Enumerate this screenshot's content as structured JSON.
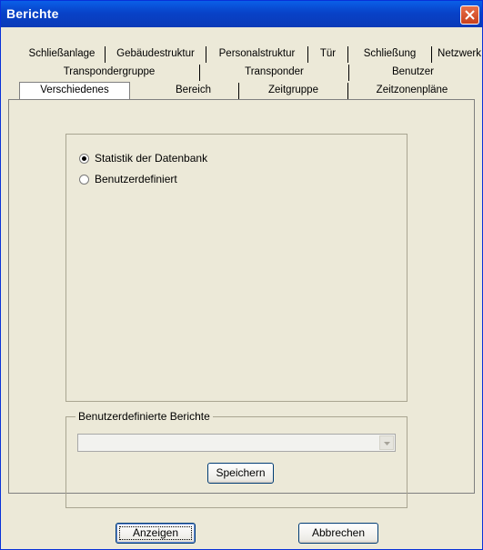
{
  "window": {
    "title": "Berichte"
  },
  "tabs": {
    "row1": [
      "Schließanlage",
      "Gebäudestruktur",
      "Personalstruktur",
      "Tür",
      "Schließung",
      "Netzwerk"
    ],
    "row2": [
      "Transpondergruppe",
      "Transponder",
      "Benutzer"
    ],
    "row3": [
      "Verschiedenes",
      "Bereich",
      "Zeitgruppe",
      "Zeitzonenpläne"
    ],
    "active": "Verschiedenes"
  },
  "options": {
    "statistik_label": "Statistik der Datenbank",
    "benutzerdefiniert_label": "Benutzerdefiniert",
    "selected": "Statistik der Datenbank"
  },
  "custom_reports": {
    "legend": "Benutzerdefinierte Berichte",
    "value": "",
    "save_label": "Speichern"
  },
  "footer": {
    "show_label": "Anzeigen",
    "cancel_label": "Abbrechen"
  }
}
